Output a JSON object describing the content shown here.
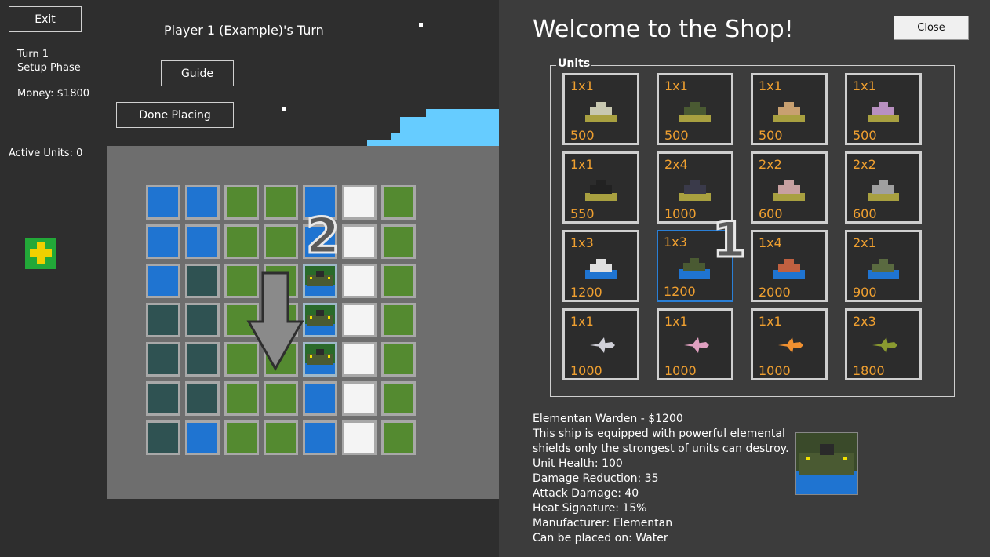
{
  "left_panel": {
    "exit_label": "Exit",
    "turn_title": "Player 1 (Example)'s Turn",
    "turn_number": "Turn 1",
    "phase": "Setup Phase",
    "money": "Money: $1800",
    "guide_label": "Guide",
    "done_label": "Done Placing",
    "active_units": "Active Units: 0",
    "annotation_2": "2"
  },
  "board": {
    "rows": [
      [
        "b",
        "b",
        "g",
        "g",
        "b",
        "w",
        "g"
      ],
      [
        "b",
        "b",
        "g",
        "g",
        "b",
        "w",
        "g"
      ],
      [
        "b",
        "d",
        "g",
        "g",
        "u",
        "w",
        "g"
      ],
      [
        "d",
        "d",
        "g",
        "g",
        "u",
        "w",
        "g"
      ],
      [
        "d",
        "d",
        "g",
        "g",
        "u",
        "w",
        "g"
      ],
      [
        "d",
        "d",
        "g",
        "g",
        "b",
        "w",
        "g"
      ],
      [
        "d",
        "b",
        "g",
        "g",
        "b",
        "w",
        "g"
      ]
    ]
  },
  "shop": {
    "title": "Welcome to the Shop!",
    "close_label": "Close",
    "units_legend": "Units",
    "annotation_1": "1",
    "units": [
      {
        "size": "1x1",
        "price": "500",
        "icon": "tank-icon"
      },
      {
        "size": "1x1",
        "price": "500",
        "icon": "dome-tank-icon"
      },
      {
        "size": "1x1",
        "price": "500",
        "icon": "desert-tank-icon"
      },
      {
        "size": "1x1",
        "price": "500",
        "icon": "spiked-tank-icon"
      },
      {
        "size": "1x1",
        "price": "550",
        "icon": "dark-tank-icon"
      },
      {
        "size": "2x4",
        "price": "1000",
        "icon": "dark-creature-icon"
      },
      {
        "size": "2x2",
        "price": "600",
        "icon": "artillery-icon"
      },
      {
        "size": "2x2",
        "price": "600",
        "icon": "flag-turret-icon"
      },
      {
        "size": "1x3",
        "price": "1200",
        "icon": "cruiser-ship-icon"
      },
      {
        "size": "1x3",
        "price": "1200",
        "icon": "warden-ship-icon"
      },
      {
        "size": "1x4",
        "price": "2000",
        "icon": "battleship-icon"
      },
      {
        "size": "2x1",
        "price": "900",
        "icon": "submarine-icon"
      },
      {
        "size": "1x1",
        "price": "1000",
        "icon": "helicopter-icon"
      },
      {
        "size": "1x1",
        "price": "1000",
        "icon": "jet-icon"
      },
      {
        "size": "1x1",
        "price": "1000",
        "icon": "fighter-icon"
      },
      {
        "size": "2x3",
        "price": "1800",
        "icon": "bomber-icon"
      }
    ]
  },
  "details": {
    "name": "Elementan Warden - $1200",
    "desc1": "This ship is equipped with powerful elemental",
    "desc2": "shields only the strongest of units can destroy.",
    "health": "Unit Health: 100",
    "reduction": "Damage Reduction: 35",
    "attack": "Attack Damage: 40",
    "heat": "Heat Signature: 15%",
    "manufacturer": "Manufacturer: Elementan",
    "placement": "Can be placed on: Water"
  },
  "colors": {
    "water": "#1f74d1",
    "grass": "#548a30",
    "deep": "#2f5252",
    "snow": "#f4f4f4",
    "price": "#f0a030",
    "sky": "#66ccff",
    "add": "#f0d000"
  }
}
